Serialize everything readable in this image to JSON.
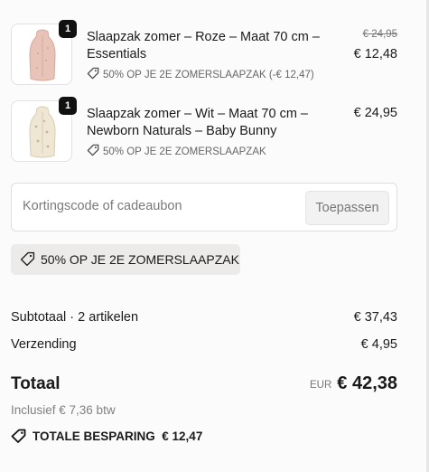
{
  "items": [
    {
      "quantity": "1",
      "title": "Slaapzak zomer – Roze – Maat 70 cm – Essentials",
      "original_price": "€ 24,95",
      "price": "€ 12,48",
      "discount": "50% OP JE 2E ZOMERSLAAPZAK (-€ 12,47)",
      "image_color": "#e8c3b8",
      "icon": "tag-icon"
    },
    {
      "quantity": "1",
      "title": "Slaapzak zomer – Wit – Maat 70 cm – Newborn Naturals – Baby Bunny",
      "price": "€ 24,95",
      "discount": "50% OP JE 2E ZOMERSLAAPZAK",
      "image_color": "#efe6d4",
      "icon": "tag-icon"
    }
  ],
  "discount_code": {
    "placeholder": "Kortingscode of cadeaubon",
    "apply_label": "Toepassen"
  },
  "applied_discount": "50% OP JE 2E ZOMERSLAAPZAK",
  "summary": {
    "subtotal_label": "Subtotaal · 2 artikelen",
    "subtotal_value": "€ 37,43",
    "shipping_label": "Verzending",
    "shipping_value": "€ 4,95",
    "total_label": "Totaal",
    "currency": "EUR",
    "total_value": "€ 42,38",
    "tax_note": "Inclusief € 7,36 btw",
    "savings_label": "TOTALE BESPARING",
    "savings_value": "€ 12,47"
  }
}
